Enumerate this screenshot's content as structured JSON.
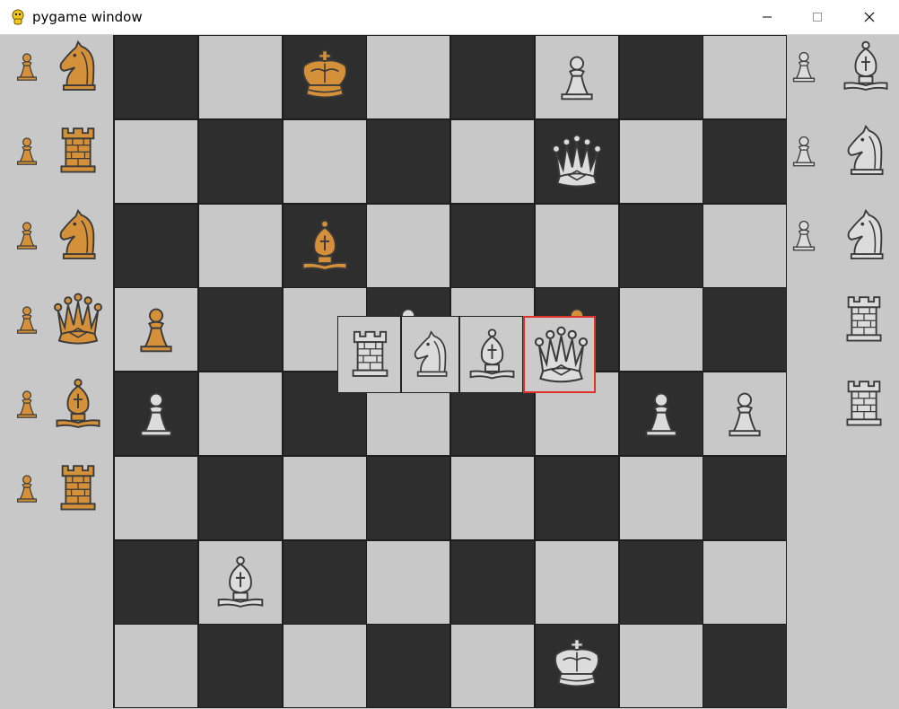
{
  "window": {
    "title": "pygame window"
  },
  "colors": {
    "light_square": "#c8c8c8",
    "dark_square": "#2e2e2e",
    "black_piece": "#d4913a",
    "white_piece": "#dcdcdc",
    "piece_outline": "#3a3a3a",
    "selection_border": "#e0302a"
  },
  "board": {
    "size": 8,
    "pieces": [
      {
        "square": "c8",
        "type": "king",
        "color": "black"
      },
      {
        "square": "f8",
        "type": "pawn",
        "color": "white"
      },
      {
        "square": "f7",
        "type": "queen",
        "color": "white"
      },
      {
        "square": "c6",
        "type": "bishop",
        "color": "black"
      },
      {
        "square": "a5",
        "type": "pawn",
        "color": "black"
      },
      {
        "square": "d5",
        "type": "pawn",
        "color": "white"
      },
      {
        "square": "f5",
        "type": "pawn",
        "color": "black"
      },
      {
        "square": "a4",
        "type": "pawn",
        "color": "white"
      },
      {
        "square": "g4",
        "type": "pawn",
        "color": "white"
      },
      {
        "square": "h4",
        "type": "pawn",
        "color": "white"
      },
      {
        "square": "b2",
        "type": "bishop",
        "color": "white"
      },
      {
        "square": "f1",
        "type": "king",
        "color": "white"
      }
    ]
  },
  "captured": {
    "left": [
      [
        "pawn",
        "knight"
      ],
      [
        "pawn",
        "rook"
      ],
      [
        "pawn",
        "knight"
      ],
      [
        "pawn",
        "queen"
      ],
      [
        "pawn",
        "bishop"
      ],
      [
        "pawn",
        "rook"
      ]
    ],
    "right": [
      [
        "pawn",
        "bishop"
      ],
      [
        "pawn",
        "knight"
      ],
      [
        "pawn",
        "knight"
      ],
      [
        "rook"
      ],
      [
        "rook"
      ]
    ]
  },
  "promotion": {
    "color": "white",
    "options": [
      "rook",
      "knight",
      "bishop",
      "queen"
    ],
    "selected": "queen"
  }
}
